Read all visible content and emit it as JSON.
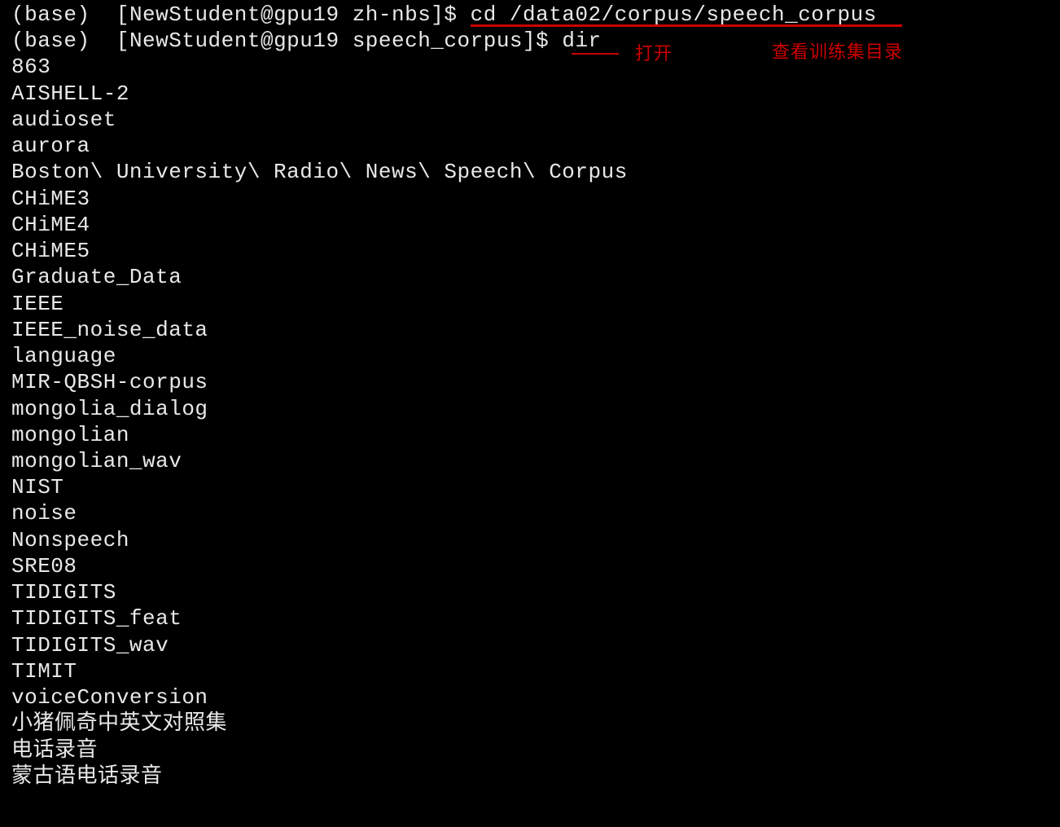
{
  "prompt1": {
    "env": "(base)",
    "userhost": "[NewStudent@gpu19 zh-nbs]$",
    "command": "cd /data02/corpus/speech_corpus"
  },
  "prompt2": {
    "env": "(base)",
    "userhost": "[NewStudent@gpu19 speech_corpus]$",
    "command": "dir"
  },
  "annotations": {
    "open": "打开",
    "viewdir": "查看训练集目录"
  },
  "listing": [
    "863",
    "AISHELL-2",
    "audioset",
    "aurora",
    "Boston\\ University\\ Radio\\ News\\ Speech\\ Corpus",
    "CHiME3",
    "CHiME4",
    "CHiME5",
    "Graduate_Data",
    "IEEE",
    "IEEE_noise_data",
    "language",
    "MIR-QBSH-corpus",
    "mongolia_dialog",
    "mongolian",
    "mongolian_wav",
    "NIST",
    "noise",
    "Nonspeech",
    "SRE08",
    "TIDIGITS",
    "TIDIGITS_feat",
    "TIDIGITS_wav",
    "TIMIT",
    "voiceConversion",
    "小猪佩奇中英文对照集",
    "电话录音",
    "蒙古语电话录音"
  ]
}
